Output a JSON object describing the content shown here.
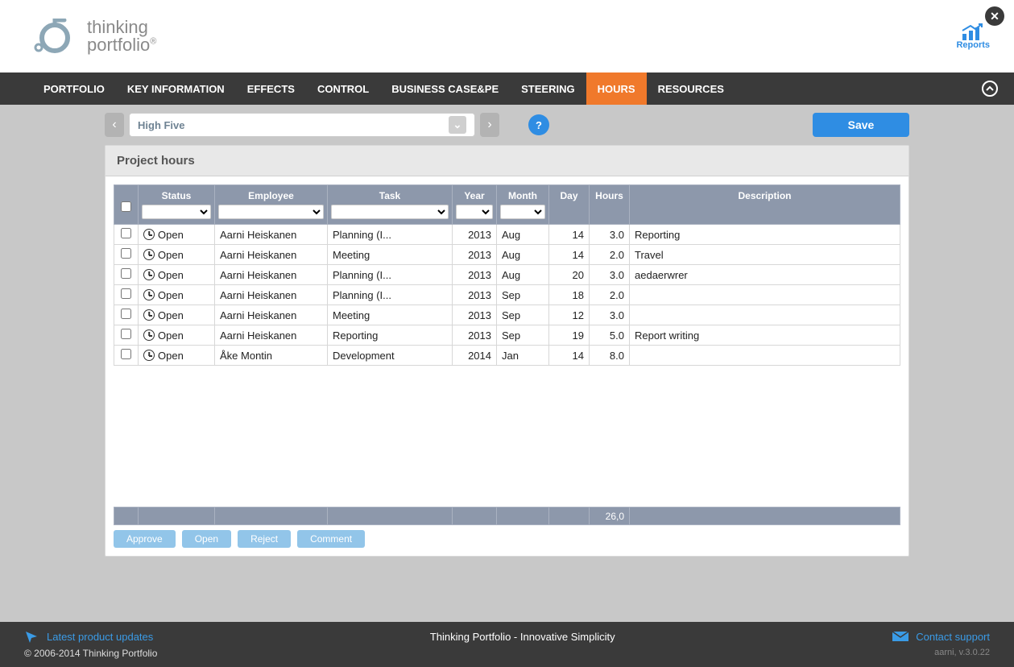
{
  "header": {
    "brand_line1": "thinking",
    "brand_line2": "portfolio",
    "brand_sup": "®",
    "reports_label": "Reports"
  },
  "nav": {
    "items": [
      "PORTFOLIO",
      "KEY INFORMATION",
      "EFFECTS",
      "CONTROL",
      "BUSINESS CASE&PE",
      "STEERING",
      "HOURS",
      "RESOURCES"
    ],
    "active_index": 6
  },
  "toolbar": {
    "project_name": "High Five",
    "help": "?",
    "save": "Save"
  },
  "panel": {
    "title": "Project hours"
  },
  "columns": {
    "status": "Status",
    "employee": "Employee",
    "task": "Task",
    "year": "Year",
    "month": "Month",
    "day": "Day",
    "hours": "Hours",
    "description": "Description"
  },
  "rows": [
    {
      "status": "Open",
      "employee": "Aarni Heiskanen",
      "task": "Planning (I...",
      "year": "2013",
      "month": "Aug",
      "day": "14",
      "hours": "3.0",
      "description": "Reporting"
    },
    {
      "status": "Open",
      "employee": "Aarni Heiskanen",
      "task": "Meeting",
      "year": "2013",
      "month": "Aug",
      "day": "14",
      "hours": "2.0",
      "description": "Travel"
    },
    {
      "status": "Open",
      "employee": "Aarni Heiskanen",
      "task": "Planning (I...",
      "year": "2013",
      "month": "Aug",
      "day": "20",
      "hours": "3.0",
      "description": "aedaerwrer"
    },
    {
      "status": "Open",
      "employee": "Aarni Heiskanen",
      "task": "Planning (I...",
      "year": "2013",
      "month": "Sep",
      "day": "18",
      "hours": "2.0",
      "description": ""
    },
    {
      "status": "Open",
      "employee": "Aarni Heiskanen",
      "task": "Meeting",
      "year": "2013",
      "month": "Sep",
      "day": "12",
      "hours": "3.0",
      "description": ""
    },
    {
      "status": "Open",
      "employee": "Aarni Heiskanen",
      "task": "Reporting",
      "year": "2013",
      "month": "Sep",
      "day": "19",
      "hours": "5.0",
      "description": "Report writing"
    },
    {
      "status": "Open",
      "employee": "Åke Montin",
      "task": "Development",
      "year": "2014",
      "month": "Jan",
      "day": "14",
      "hours": "8.0",
      "description": ""
    }
  ],
  "totals": {
    "hours": "26,0"
  },
  "actions": {
    "approve": "Approve",
    "open": "Open",
    "reject": "Reject",
    "comment": "Comment"
  },
  "footer": {
    "updates": "Latest product updates",
    "tagline": "Thinking Portfolio - Innovative Simplicity",
    "contact": "Contact support",
    "copyright": "© 2006-2014 Thinking Portfolio",
    "version": "aarni, v.3.0.22"
  }
}
